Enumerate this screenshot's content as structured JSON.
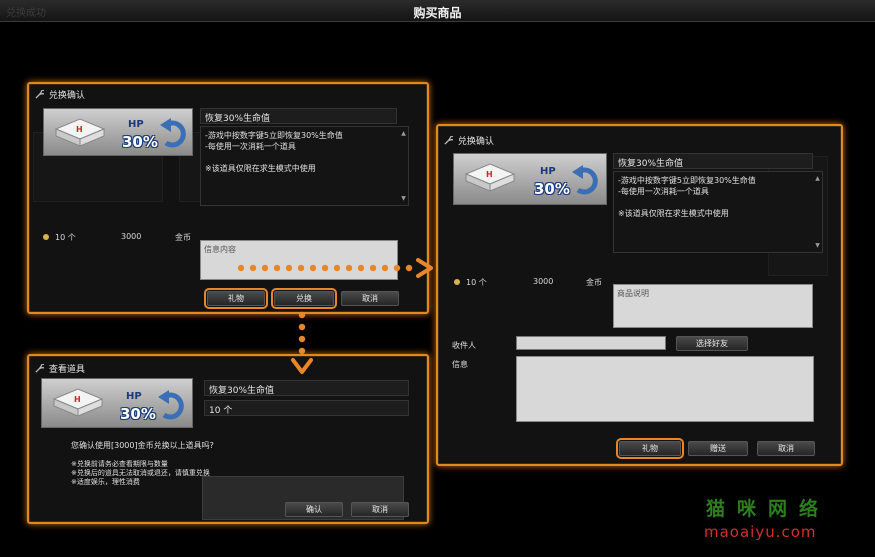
{
  "window": {
    "title": "购买商品",
    "ghost_title": "兑换成功"
  },
  "item": {
    "name": "恢复30%生命值",
    "hp_text": "HP",
    "pct_text": "30%",
    "desc": [
      "-游戏中按数字键5立即恢复30%生命值",
      "-每使用一次消耗一个道具",
      "",
      "※该道具仅限在求生模式中使用"
    ]
  },
  "dialog_a": {
    "title": "兑换确认",
    "qty": "10 个",
    "price": "3000",
    "currency": "金币",
    "message_placeholder": "信息内容",
    "buttons": {
      "gift": "礼物",
      "exchange": "兑换",
      "cancel": "取消"
    }
  },
  "dialog_b": {
    "title": "兑换确认",
    "qty": "10 个",
    "price": "3000",
    "currency": "金币",
    "message_placeholder": "商品说明",
    "recipient_label": "收件人",
    "recipient_value": "",
    "choose_friend": "选择好友",
    "info_label": "信息",
    "buttons": {
      "gift": "礼物",
      "send": "赠送",
      "cancel": "取消"
    }
  },
  "dialog_c": {
    "title": "查看道具",
    "qty": "10 个",
    "confirm_text": "您确认使用[3000]金币兑换以上道具吗?",
    "notes": [
      "※兑换前请务必查看期限与数量",
      "※兑换后的道具无法取消或退还，请慎重兑换",
      "※适度娱乐，理性消费"
    ],
    "buttons": {
      "confirm": "确认",
      "cancel": "取消"
    }
  },
  "watermark": {
    "cn": "猫咪网络",
    "en": "maoaiyu.com"
  },
  "colors": {
    "accent": "#e8862a",
    "highlight_border": "#e0891e",
    "watermark_green": "#2e7d1f",
    "watermark_red": "#d03030"
  }
}
